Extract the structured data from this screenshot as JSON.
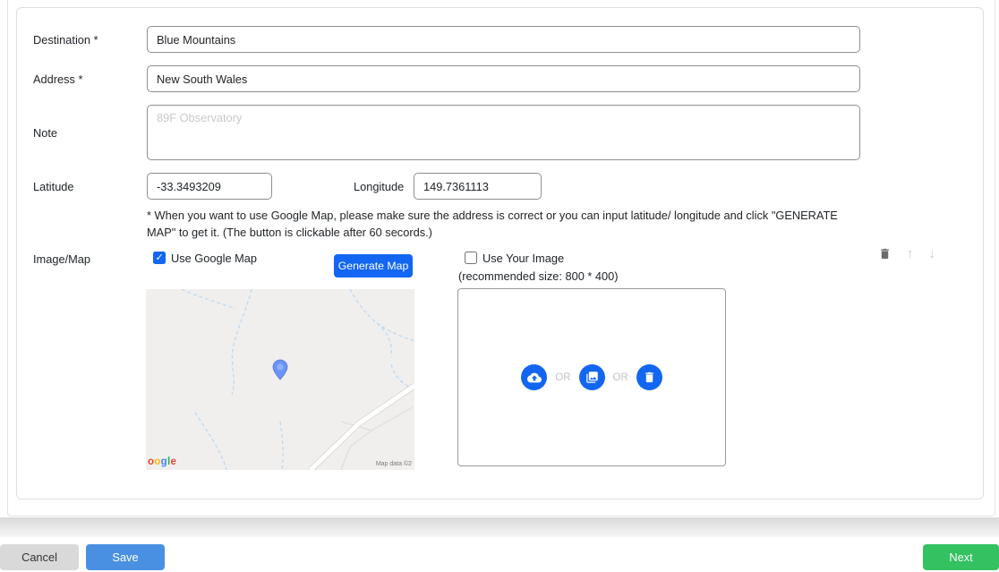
{
  "form": {
    "destination": {
      "label": "Destination *",
      "value": "Blue Mountains"
    },
    "address": {
      "label": "Address *",
      "value": "New South Wales"
    },
    "note": {
      "label": "Note",
      "placeholder": "89F Observatory",
      "value": ""
    },
    "latitude": {
      "label": "Latitude",
      "value": "-33.3493209"
    },
    "longitude": {
      "label": "Longitude",
      "value": "149.7361113"
    },
    "map_help": "* When you want to use Google Map, please make sure the address is correct or you can input latitude/ longitude and click \"GENERATE MAP\" to get it. (The button is clickable after 60 secords.)",
    "image_map": {
      "label": "Image/Map",
      "use_google_map": {
        "label": "Use Google Map",
        "checked": true
      },
      "generate_map_label": "Generate Map",
      "use_your_image": {
        "label": "Use Your Image",
        "checked": false
      },
      "recommended_size": "(recommended size: 800 * 400)",
      "or_label_1": "OR",
      "or_label_2": "OR"
    }
  },
  "map_preview": {
    "logo_letters": [
      {
        "ch": "o",
        "color": "#ea4335"
      },
      {
        "ch": "o",
        "color": "#fbbc05"
      },
      {
        "ch": "g",
        "color": "#4285f4"
      },
      {
        "ch": "l",
        "color": "#34a853"
      },
      {
        "ch": "e",
        "color": "#ea4335"
      }
    ],
    "attribution": "Map data ©2"
  },
  "icons": {
    "row_trash": "trash-icon",
    "row_move_up": "arrow-up-icon",
    "row_move_down": "arrow-down-icon",
    "upload_cloud": "cloud-upload-icon",
    "gallery": "photo-library-icon",
    "upload_trash": "trash-icon",
    "arrow_up_glyph": "↑",
    "arrow_down_glyph": "↓"
  },
  "footer": {
    "cancel_label": "Cancel",
    "save_label": "Save",
    "next_label": "Next"
  },
  "colors": {
    "primary_blue": "#1266f1",
    "save_blue": "#4a90e2",
    "next_green": "#33c161",
    "cancel_gray": "#d9d9d9",
    "map_pin_blue": "#6b93f8"
  }
}
